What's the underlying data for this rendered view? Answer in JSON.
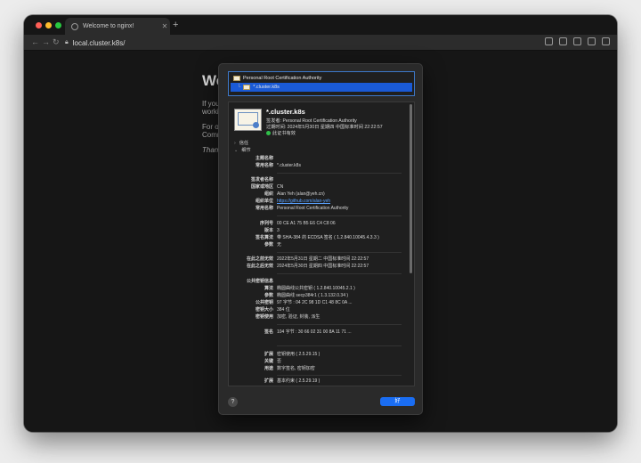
{
  "browser": {
    "tab_title": "Welcome to nginx!",
    "new_tab": "+",
    "url": "local.cluster.k8s/",
    "nav": {
      "back": "←",
      "forward": "→",
      "reload": "↻"
    },
    "page": {
      "heading_fragment": "We",
      "line1": "If you",
      "line2": "worki",
      "line3": "For o",
      "line4": "Comm",
      "line5": "Than"
    }
  },
  "certificate_sheet": {
    "tree": {
      "root": "Personal Root Certification Authority",
      "leaf": "*.cluster.k8s"
    },
    "summary": {
      "common_name": "*.cluster.k8s",
      "issuer_line": "签发者: Personal Root Certification Authority",
      "expires_line": "过期时间: 2024年5月30日 星期四 中国标准时间 22:22:57",
      "valid_line": "此证书有效"
    },
    "sections": {
      "trust": "信任",
      "details": "细节"
    },
    "fields": {
      "subject_name": {
        "heading": "主题名称",
        "common_name_label": "常用名称",
        "common_name": "*.cluster.k8s"
      },
      "issuer_name": {
        "heading": "签发者名称",
        "country_label": "国家或地区",
        "country": "CN",
        "org_label": "组织",
        "org": "Alan Yeh (alan@yeh.cn)",
        "org_unit_label": "组织单位",
        "org_unit": "https://github.com/alan-yeh",
        "common_name_label": "常用名称",
        "common_name": "Personal Root Certification Authority"
      },
      "serial_label": "序列号",
      "serial": "00 CE A1 75 B5 E6 C4 C8 06",
      "version_label": "版本",
      "version": "3",
      "sig_alg_label": "签名算法",
      "sig_alg": "带 SHA-384 的 ECDSA 签名 ( 1.2.840.10045.4.3.3 )",
      "params_label": "参数",
      "params": "无",
      "not_before_label": "在此之前无效",
      "not_before": "2022年5月31日 星期二 中国标准时间 22:22:57",
      "not_after_label": "在此之后无效",
      "not_after": "2024年5月30日 星期四 中国标准时间 22:22:57",
      "pubkey": {
        "heading": "公共密钥信息",
        "alg_label": "算法",
        "alg": "椭圆曲线公共密钥 ( 1.2.840.10045.2.1 )",
        "params_label": "参数",
        "params": "椭圆曲线 secp384r1 ( 1.3.132.0.34 )",
        "pub_label": "公共密钥",
        "pub": "97 字节 : 04 2C 98 1D C1 48 8C 0A ...",
        "size_label": "密钥大小",
        "size": "384 位",
        "usage_label": "密钥使用",
        "usage": "加密, 验证, 封装, 派生"
      },
      "signature_label": "签名",
      "signature": "104 字节 : 30 66 02 31 00 8A 11 71 ...",
      "ext1": {
        "ext_label": "扩展",
        "ext": "密钥使用 ( 2.5.29.15 )",
        "critical_label": "关键",
        "critical": "否",
        "usage_label": "用途",
        "usage": "数字签名, 密钥加密"
      },
      "ext2": {
        "ext_label": "扩展",
        "ext": "基本约束 ( 2.5.29.19 )"
      }
    },
    "buttons": {
      "help": "?",
      "ok": "好"
    }
  }
}
